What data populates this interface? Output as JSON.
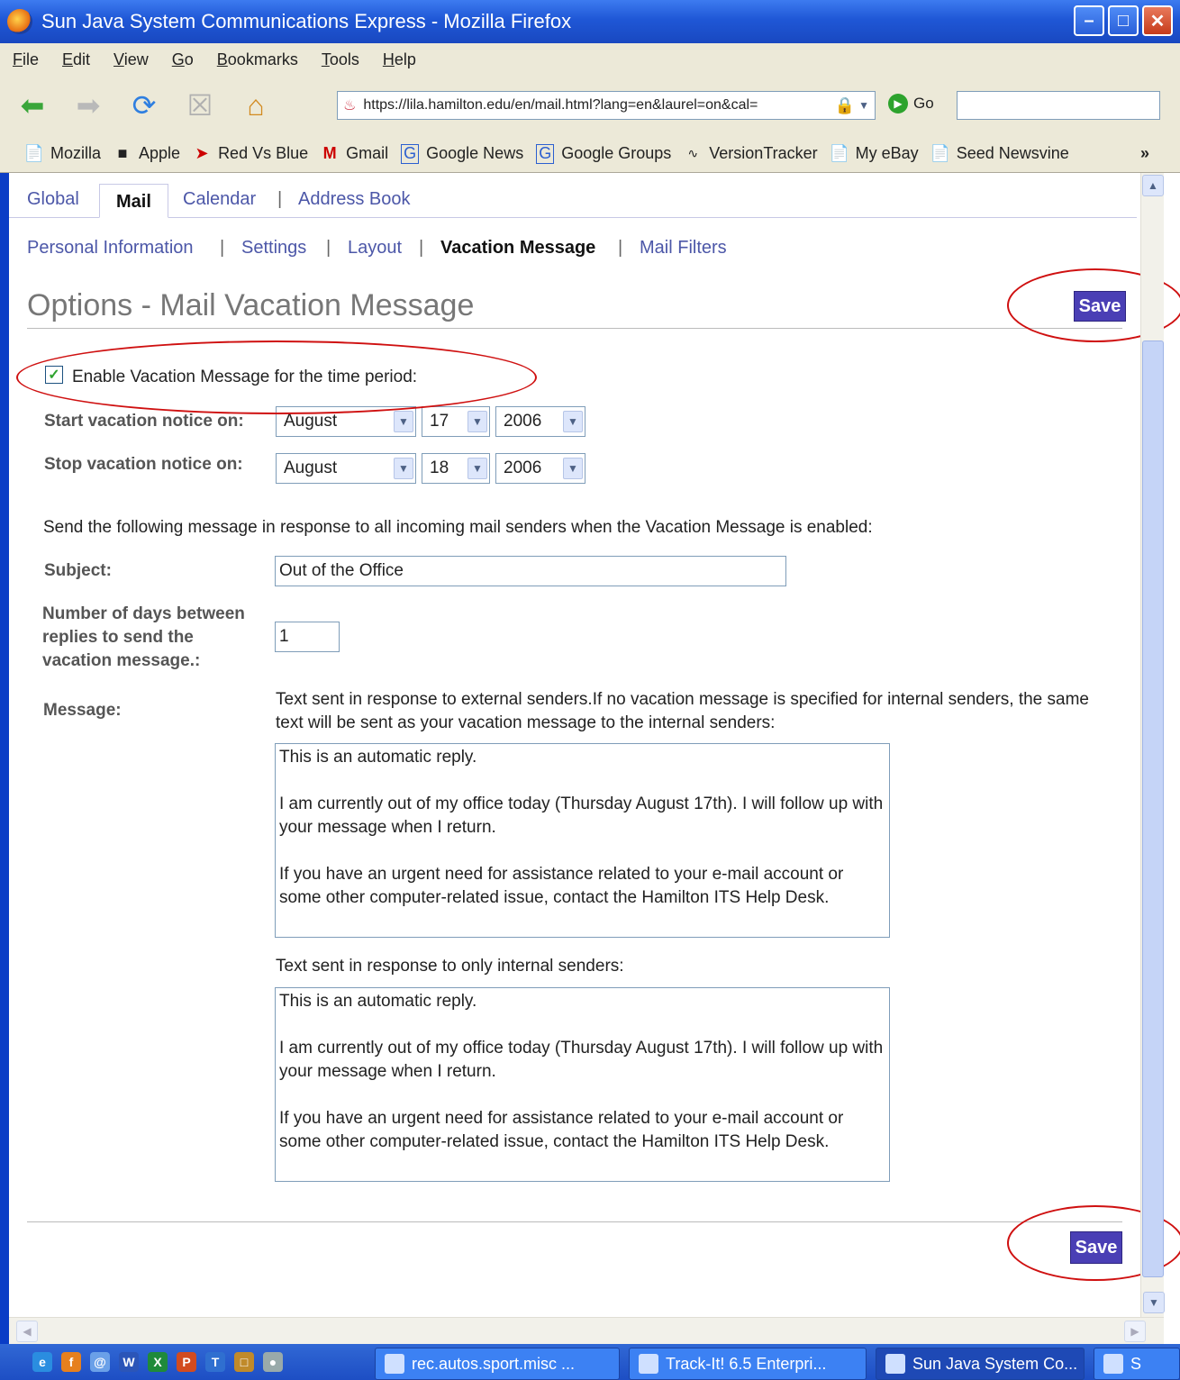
{
  "window": {
    "title": "Sun Java System Communications Express - Mozilla Firefox"
  },
  "menu": [
    "File",
    "Edit",
    "View",
    "Go",
    "Bookmarks",
    "Tools",
    "Help"
  ],
  "address": {
    "url": "https://lila.hamilton.edu/en/mail.html?lang=en&laurel=on&cal=",
    "go_label": "Go"
  },
  "bookmarks": [
    "Mozilla",
    "Apple",
    "Red Vs Blue",
    "Gmail",
    "Google News",
    "Google Groups",
    "VersionTracker",
    "My eBay",
    "Seed Newsvine"
  ],
  "bookmarks_more": "»",
  "tabs": {
    "global": "Global",
    "mail": "Mail",
    "calendar": "Calendar",
    "address_book": "Address Book"
  },
  "subnav": {
    "personal": "Personal Information",
    "settings": "Settings",
    "layout": "Layout",
    "vacation": "Vacation Message",
    "filters": "Mail Filters"
  },
  "separator": "|",
  "page": {
    "title": "Options - Mail Vacation Message",
    "save_label": "Save",
    "enable_label": "Enable Vacation Message for the time period:",
    "start_label": "Start vacation notice on:",
    "stop_label": "Stop vacation notice on:",
    "start": {
      "month": "August",
      "day": "17",
      "year": "2006"
    },
    "stop": {
      "month": "August",
      "day": "18",
      "year": "2006"
    },
    "send_text": "Send the following message in response to all incoming mail senders when the Vacation Message is enabled:",
    "subject_label": "Subject:",
    "subject_value": "Out of the Office",
    "days_label": "Number of days between replies to send the vacation message.:",
    "days_value": "1",
    "message_label": "Message:",
    "external_note": "Text sent in response to external senders.If no vacation message is specified for internal senders, the same text will be sent as your vacation message to the internal senders:",
    "external_message": "This is an automatic reply.\n\nI am currently out of my office today (Thursday August 17th). I will follow up with your message when I return.\n\nIf you have an urgent need for assistance related to your e-mail account or some other computer-related issue, contact the Hamilton ITS Help Desk.",
    "internal_note": "Text sent in response to only internal senders:",
    "internal_message": "This is an automatic reply.\n\nI am currently out of my office today (Thursday August 17th). I will follow up with your message when I return.\n\nIf you have an urgent need for assistance related to your e-mail account or some other computer-related issue, contact the Hamilton ITS Help Desk."
  },
  "taskbar": {
    "tasks": [
      "rec.autos.sport.misc ...",
      "Track-It! 6.5 Enterpri...",
      "Sun Java System Co...",
      "S"
    ]
  }
}
